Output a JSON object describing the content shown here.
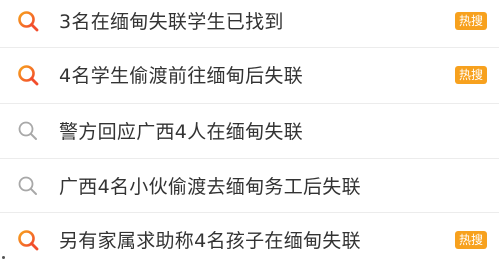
{
  "search_list": {
    "items": [
      {
        "label": "3名在缅甸失联学生已找到",
        "icon": "hot-search-icon",
        "badge": "热搜"
      },
      {
        "label": "4名学生偷渡前往缅甸后失联",
        "icon": "hot-search-icon",
        "badge": "热搜"
      },
      {
        "label": "警方回应广西4人在缅甸失联",
        "icon": "search-icon",
        "badge": ""
      },
      {
        "label": "广西4名小伙偷渡去缅甸务工后失联",
        "icon": "search-icon",
        "badge": ""
      },
      {
        "label": "另有家属求助称4名孩子在缅甸失联",
        "icon": "hot-search-icon",
        "badge": "热搜"
      }
    ]
  },
  "colors": {
    "text": "#333333",
    "badge_bg": "#f7a11e",
    "hot_icon_gradient": [
      "#f24d2c",
      "#f7a11e"
    ],
    "plain_icon": "#a8a8a8",
    "divider": "#ececec"
  }
}
